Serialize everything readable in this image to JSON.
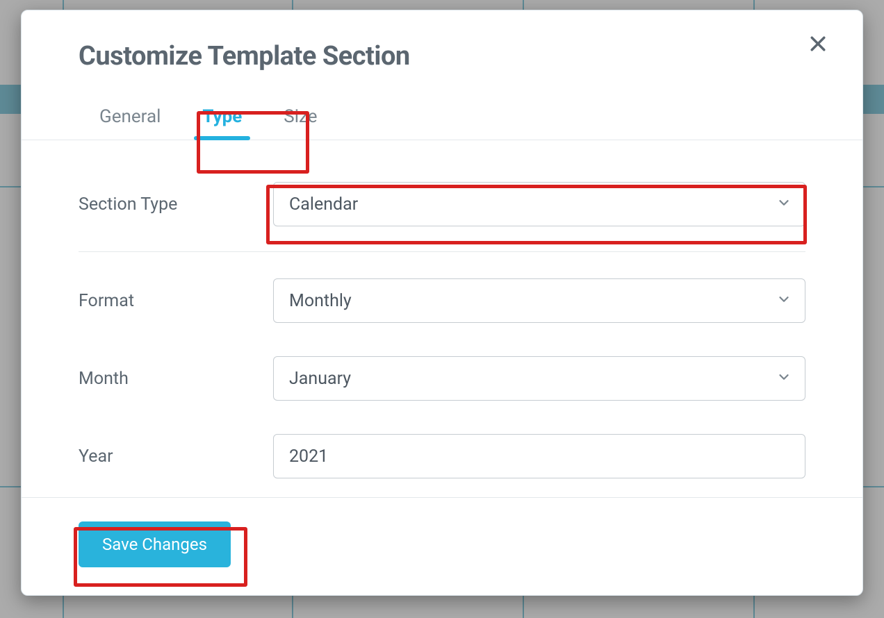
{
  "modal": {
    "title": "Customize Template Section",
    "tabs": {
      "general": "General",
      "type": "Type",
      "size": "Size",
      "active": "type"
    },
    "form": {
      "section_type_label": "Section Type",
      "section_type_value": "Calendar",
      "format_label": "Format",
      "format_value": "Monthly",
      "month_label": "Month",
      "month_value": "January",
      "year_label": "Year",
      "year_value": "2021"
    },
    "footer": {
      "save_label": "Save Changes"
    }
  },
  "highlights": [
    "tab-type",
    "section-type-select",
    "save-button"
  ],
  "colors": {
    "accent": "#24b1df",
    "highlight_border": "#d8201f",
    "text_muted": "#5b6670"
  }
}
